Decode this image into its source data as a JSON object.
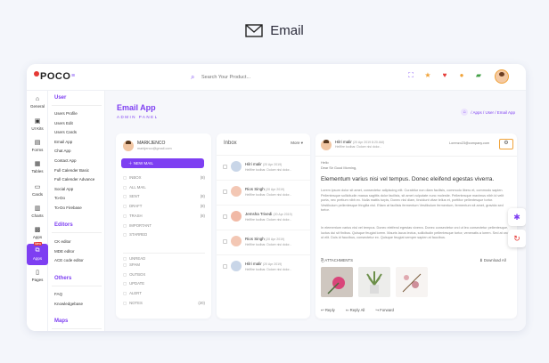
{
  "banner": {
    "title": "Email"
  },
  "header": {
    "logo": "POCO",
    "search_placeholder": "Search Your Product...",
    "icons": [
      "fullscreen-icon",
      "star-icon",
      "heart-icon",
      "bell-icon",
      "flag-icon"
    ]
  },
  "rail": [
    {
      "label": "General",
      "icon": "⌂"
    },
    {
      "label": "UI Kits",
      "icon": "▣"
    },
    {
      "label": "Forms",
      "icon": "▤"
    },
    {
      "label": "Tables",
      "icon": "▦"
    },
    {
      "label": "Cards",
      "icon": "▭"
    },
    {
      "label": "Charts",
      "icon": "▥"
    },
    {
      "label": "Apps",
      "icon": "▩"
    },
    {
      "label": "Apps",
      "icon": "⧉"
    },
    {
      "label": "Pages",
      "icon": "▯"
    }
  ],
  "submenu": {
    "user_head": "User",
    "user_items": [
      "Users Profile",
      "Users Edit",
      "Users Cards",
      "Email App",
      "Chat App",
      "Contact App",
      "Full Calender Basic",
      "Full Calender Advance",
      "Social App",
      "To-Do",
      "To-Do Firebase"
    ],
    "editors_head": "Editors",
    "editor_items": [
      "CK editor",
      "MDE editor",
      "ACE code editor"
    ],
    "others_head": "Others",
    "other_items": [
      "FAQ",
      "Knowledgebase"
    ],
    "maps_head": "Maps",
    "new_badge": "New"
  },
  "page": {
    "title": "Email App",
    "subtitle": "ADMIN PANEL",
    "breadcrumb": "/ Apps / User / Email App"
  },
  "left": {
    "name": "MARKJENCO",
    "email": "markjenco@gmail.com",
    "new_mail": "NEW MAIL",
    "folders": [
      {
        "label": "INBOX",
        "count": "(8)"
      },
      {
        "label": "ALL MAIL",
        "count": ""
      },
      {
        "label": "SENT",
        "count": "(8)"
      },
      {
        "label": "DRAFT",
        "count": "(8)"
      },
      {
        "label": "TRASH",
        "count": "(8)"
      },
      {
        "label": "IMPORTANT",
        "count": ""
      },
      {
        "label": "STARRED",
        "count": ""
      }
    ],
    "labels": [
      {
        "label": "UNREAD",
        "count": ""
      },
      {
        "label": "SPAM",
        "count": ""
      },
      {
        "label": "OUTBOX",
        "count": ""
      },
      {
        "label": "UPDATE",
        "count": ""
      },
      {
        "label": "ALERT",
        "count": ""
      },
      {
        "label": "NOTES",
        "count": "(20)"
      }
    ]
  },
  "inbox": {
    "title": "Inbox",
    "more": "More",
    "messages": [
      {
        "name": "Hilri malir",
        "date": "(20 Apr 2019)",
        "snippet": "Hellfire toolbar. Dolore nisi dolor..."
      },
      {
        "name": "Rios Singh",
        "date": "(20 Apr 2019)",
        "snippet": "Hellfire toolbar. Dolore nisi dolor..."
      },
      {
        "name": "Jemsha Trivedi",
        "date": "(20 Apr 2019)",
        "snippet": "Hellfire toolbar. Dolore nisi dolor..."
      },
      {
        "name": "Rios Singh",
        "date": "(20 Apr 2019)",
        "snippet": "Hellfire toolbar. Dolore nisi dolor..."
      },
      {
        "name": "Hilri malir",
        "date": "(20 Apr 2019)",
        "snippet": "Hellfire toolbar. Dolore nisi dolor..."
      }
    ]
  },
  "reader": {
    "from": "Hilri malir",
    "date": "(20 Apr 2019 8:20 AM)",
    "from_sub": "Hellfire toolbar. Dolore nisi dolor...",
    "to": "Lorenzo23@company.com",
    "hello": "Hello",
    "dear": "Dear Sir Good Morning,",
    "subject": "Elementum varius nisi vel tempus. Donec eleifend egestas viverra.",
    "para1": "Lorem ipsum dolor sit amet, consectetur adipiscing elit. Curabitur non diam facilisis, commodo libero et, commodo sapien. Pellentesque sollicitudin massa sagittis dolor facilisis, sit amet vulputate nunc molestie. Pellentesque maximus nibh id velit porta, nec pretium nibh ex. Nulla mattis turpis, Donec nisi diam, tincidunt vitae tellus et, porttitor pellentesque tortor. Vestibulum pellentesque fringilla nisl. Etiam at facilisis fermentum Vestibulum fermentum, fermentum sit amet, gravida sed tortor.",
    "para2": "In elementum varius nisi vel tempus. Donec eleifend egestas viverra. Donec consectetur orci ut leo consectetur pellentesque, luctus dui sit finibus. Quisque feugiat lorem. Mauris lacus lectus, sollicitudin pellentesque tortor, venenatis a lorem. Sed at orci ut elit. Duis id faucibus, consectetur ex. Quisque feugiat semper sapien at faucibus.",
    "attachments_label": "ATTACHMENTS",
    "download_all": "Download All",
    "reply": "Reply",
    "reply_all": "Reply All",
    "forward": "Forward"
  },
  "colors": {
    "accent": "#7e3ff2",
    "highlight": "#f0a33a"
  }
}
